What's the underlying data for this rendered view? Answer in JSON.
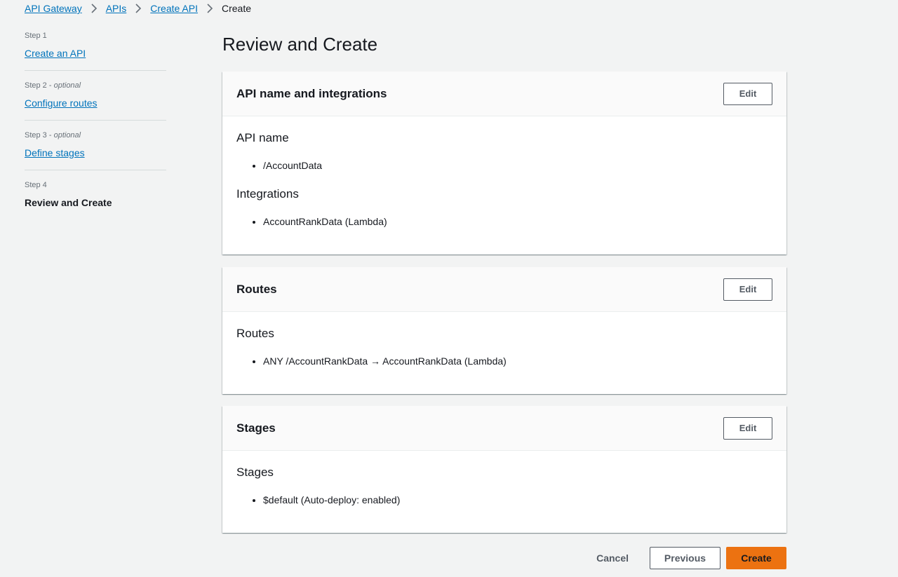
{
  "breadcrumb": {
    "items": [
      "API Gateway",
      "APIs",
      "Create API"
    ],
    "current": "Create"
  },
  "steps": [
    {
      "label": "Step 1",
      "optional": "",
      "title": "Create an API"
    },
    {
      "label": "Step 2 - ",
      "optional": "optional",
      "title": "Configure routes"
    },
    {
      "label": "Step 3 - ",
      "optional": "optional",
      "title": "Define stages"
    },
    {
      "label": "Step 4",
      "optional": "",
      "title": "Review and Create"
    }
  ],
  "page_title": "Review and Create",
  "cards": {
    "api": {
      "header": "API name and integrations",
      "edit_label": "Edit",
      "section1_title": "API name",
      "section1_items": [
        "/AccountData"
      ],
      "section2_title": "Integrations",
      "section2_items": [
        "AccountRankData (Lambda)"
      ]
    },
    "routes": {
      "header": "Routes",
      "edit_label": "Edit",
      "section_title": "Routes",
      "items": [
        "ANY /AccountRankData → AccountRankData (Lambda)"
      ]
    },
    "stages": {
      "header": "Stages",
      "edit_label": "Edit",
      "section_title": "Stages",
      "items": [
        "$default (Auto-deploy: enabled)"
      ]
    }
  },
  "actions": {
    "cancel": "Cancel",
    "previous": "Previous",
    "create": "Create"
  },
  "colors": {
    "link": "#0073bb",
    "primary_button": "#ec7211",
    "background": "#f2f3f3"
  }
}
